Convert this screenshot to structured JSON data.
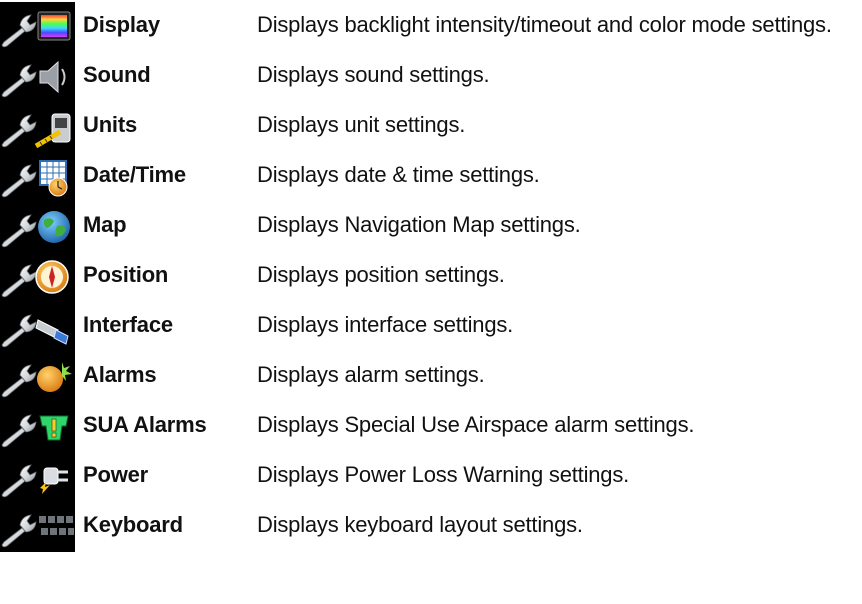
{
  "items": [
    {
      "icon": "wrench-display-icon",
      "name": "Display",
      "description": "Displays backlight intensity/timeout and color mode settings."
    },
    {
      "icon": "wrench-speaker-icon",
      "name": "Sound",
      "description": "Displays sound settings."
    },
    {
      "icon": "wrench-units-icon",
      "name": "Units",
      "description": "Displays unit settings."
    },
    {
      "icon": "wrench-calendar-clock-icon",
      "name": "Date/Time",
      "description": "Displays date & time settings."
    },
    {
      "icon": "wrench-globe-icon",
      "name": "Map",
      "description": "Displays Navigation Map settings."
    },
    {
      "icon": "wrench-compass-icon",
      "name": "Position",
      "description": "Displays position settings."
    },
    {
      "icon": "wrench-connector-icon",
      "name": "Interface",
      "description": "Displays interface settings."
    },
    {
      "icon": "wrench-alarm-bell-icon",
      "name": "Alarms",
      "description": "Displays alarm settings."
    },
    {
      "icon": "wrench-sua-alarm-icon",
      "name": "SUA Alarms",
      "description": "Displays Special Use Airspace alarm settings."
    },
    {
      "icon": "wrench-power-plug-icon",
      "name": "Power",
      "description": "Displays Power Loss Warning settings."
    },
    {
      "icon": "wrench-keyboard-icon",
      "name": "Keyboard",
      "description": "Displays keyboard layout settings."
    }
  ]
}
